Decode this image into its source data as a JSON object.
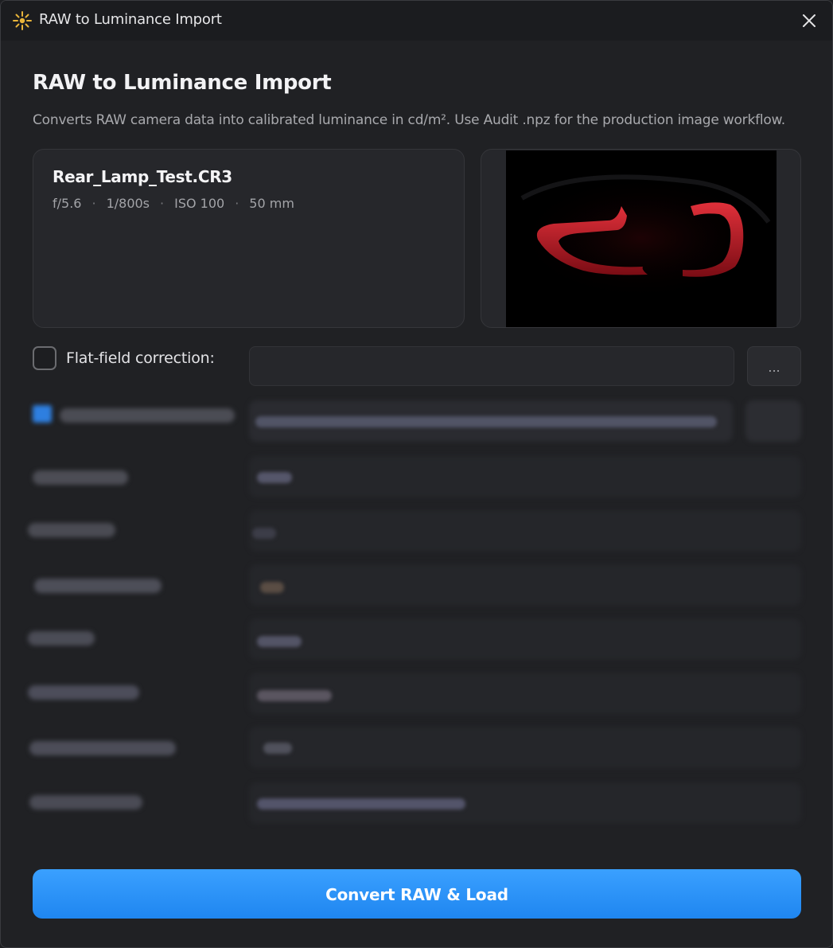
{
  "window": {
    "title": "RAW to Luminance Import"
  },
  "header": {
    "heading": "RAW to Luminance Import",
    "description": "Converts RAW camera data into calibrated luminance in cd/m². Use Audit .npz for the production image workflow."
  },
  "file": {
    "name": "Rear_Lamp_Test.CR3",
    "aperture": "f/5.6",
    "shutter": "1/800s",
    "iso": "ISO 100",
    "focal": "50 mm",
    "separator": "·"
  },
  "flat_field": {
    "label": "Flat-field correction:",
    "value": "",
    "checked": false,
    "browse_label": "..."
  },
  "actions": {
    "convert_label": "Convert RAW & Load"
  },
  "colors": {
    "accent": "#2b93f8",
    "background": "#202124",
    "card": "#26272b"
  },
  "icons": {
    "app": "sparkle-icon",
    "close": "close-icon"
  }
}
